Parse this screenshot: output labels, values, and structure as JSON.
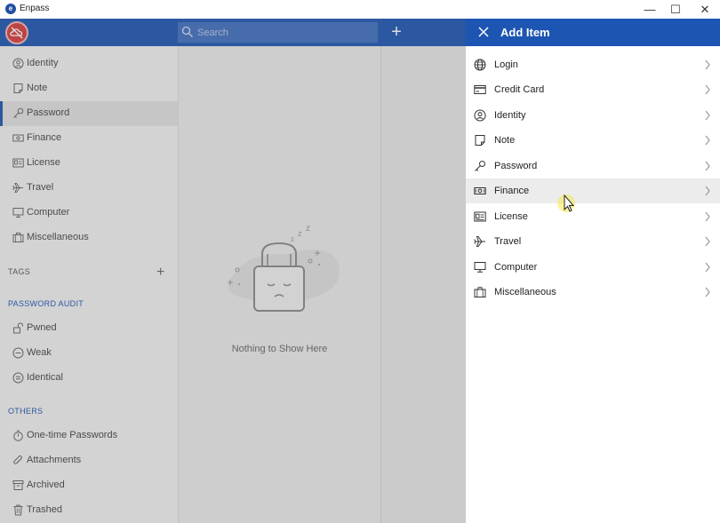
{
  "window": {
    "title": "Enpass",
    "minimize": "—",
    "maximize": "☐",
    "close": "✕"
  },
  "header": {
    "search_placeholder": "Search",
    "add_label": "+"
  },
  "sidebar": {
    "categories": [
      {
        "label": "Identity",
        "icon": "identity-icon"
      },
      {
        "label": "Note",
        "icon": "note-icon"
      },
      {
        "label": "Password",
        "icon": "key-icon"
      },
      {
        "label": "Finance",
        "icon": "finance-icon"
      },
      {
        "label": "License",
        "icon": "license-icon"
      },
      {
        "label": "Travel",
        "icon": "plane-icon"
      },
      {
        "label": "Computer",
        "icon": "monitor-icon"
      },
      {
        "label": "Miscellaneous",
        "icon": "briefcase-icon"
      }
    ],
    "tags_title": "TAGS",
    "tags_add": "+",
    "audit_title": "PASSWORD AUDIT",
    "audit": [
      {
        "label": "Pwned",
        "icon": "unlock-icon"
      },
      {
        "label": "Weak",
        "icon": "weak-icon"
      },
      {
        "label": "Identical",
        "icon": "identical-icon"
      }
    ],
    "others_title": "OTHERS",
    "others": [
      {
        "label": "One-time Passwords",
        "icon": "stopwatch-icon"
      },
      {
        "label": "Attachments",
        "icon": "paperclip-icon"
      },
      {
        "label": "Archived",
        "icon": "archive-icon"
      },
      {
        "label": "Trashed",
        "icon": "trash-icon"
      }
    ]
  },
  "list": {
    "empty_text": "Nothing to Show Here"
  },
  "add_item": {
    "title": "Add Item",
    "items": [
      {
        "label": "Login",
        "icon": "globe-icon"
      },
      {
        "label": "Credit Card",
        "icon": "credit-card-icon"
      },
      {
        "label": "Identity",
        "icon": "identity-icon"
      },
      {
        "label": "Note",
        "icon": "note-icon"
      },
      {
        "label": "Password",
        "icon": "key-icon"
      },
      {
        "label": "Finance",
        "icon": "finance-icon"
      },
      {
        "label": "License",
        "icon": "license-icon"
      },
      {
        "label": "Travel",
        "icon": "plane-icon"
      },
      {
        "label": "Computer",
        "icon": "monitor-icon"
      },
      {
        "label": "Miscellaneous",
        "icon": "briefcase-icon"
      }
    ]
  },
  "colors": {
    "accent": "#1d55b3",
    "sync_button": "#d83b3b",
    "cursor_highlight": "#f5e94a"
  }
}
